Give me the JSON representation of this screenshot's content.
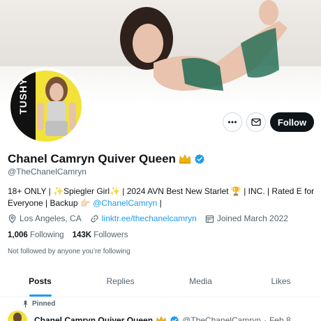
{
  "profile": {
    "display_name": "Chanel Camryn Quiver Queen",
    "handle": "@TheChanelCamryn",
    "avatar_logo": "TUSHY",
    "bio_text": "18+ ONLY | ✨Spiegler Girl✨ | 2024 AVN Best New Starlet 🏆 | INC. | Rated E for Everyone | Backup 👉🏻 ",
    "bio_link": "@ChanelCamryn",
    "bio_tail": " |",
    "location": "Los Angeles, CA",
    "website": "linktr.ee/thechanelcamryn",
    "joined": "Joined March 2022",
    "following_count": "1,006",
    "following_label": "Following",
    "followers_count": "143K",
    "followers_label": "Followers",
    "not_followed": "Not followed by anyone you’re following"
  },
  "actions": {
    "follow_label": "Follow"
  },
  "tabs": [
    {
      "label": "Posts"
    },
    {
      "label": "Replies"
    },
    {
      "label": "Media"
    },
    {
      "label": "Likes"
    }
  ],
  "post": {
    "pinned_label": "Pinned",
    "author_name": "Chanel Camryn Quiver Queen",
    "author_handle": "@TheChanelCamryn",
    "separator": "·",
    "date": "Feb 8"
  },
  "colors": {
    "accent": "#1d9bf0",
    "text_secondary": "#536471",
    "follow_button": "#0f1419"
  },
  "icons": [
    "more-icon",
    "mail-icon",
    "verified-icon",
    "crown-icon",
    "location-icon",
    "link-icon",
    "calendar-icon",
    "pin-icon"
  ]
}
